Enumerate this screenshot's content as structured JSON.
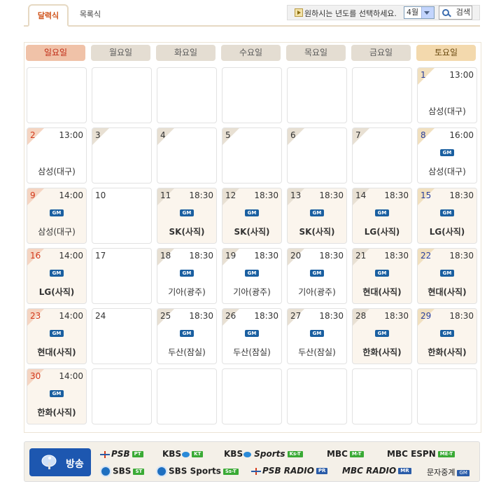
{
  "tabs": {
    "calendar": "달력식",
    "list": "목록식"
  },
  "selector": {
    "prompt": "원하시는 년도를 선택하세요.",
    "month": "4월",
    "search": "검색"
  },
  "weekdays": [
    "일요일",
    "월요일",
    "화요일",
    "수요일",
    "목요일",
    "금요일",
    "토요일"
  ],
  "days": {
    "d1": {
      "num": "1",
      "time": "13:00",
      "opp": "삼성(대구)",
      "gm": ""
    },
    "d2": {
      "num": "2",
      "time": "13:00",
      "opp": "삼성(대구)",
      "gm": ""
    },
    "d3": {
      "num": "3"
    },
    "d4": {
      "num": "4"
    },
    "d5": {
      "num": "5"
    },
    "d6": {
      "num": "6"
    },
    "d7": {
      "num": "7"
    },
    "d8": {
      "num": "8",
      "time": "16:00",
      "opp": "삼성(대구)",
      "gm": "GM"
    },
    "d9": {
      "num": "9",
      "time": "14:00",
      "opp": "삼성(대구)",
      "gm": "GM"
    },
    "d10": {
      "num": "10"
    },
    "d11": {
      "num": "11",
      "time": "18:30",
      "opp": "SK(사직)",
      "gm": "GM"
    },
    "d12": {
      "num": "12",
      "time": "18:30",
      "opp": "SK(사직)",
      "gm": "GM"
    },
    "d13": {
      "num": "13",
      "time": "18:30",
      "opp": "SK(사직)",
      "gm": "GM"
    },
    "d14": {
      "num": "14",
      "time": "18:30",
      "opp": "LG(사직)",
      "gm": "GM"
    },
    "d15": {
      "num": "15",
      "time": "18:30",
      "opp": "LG(사직)",
      "gm": "GM"
    },
    "d16": {
      "num": "16",
      "time": "14:00",
      "opp": "LG(사직)",
      "gm": "GM"
    },
    "d17": {
      "num": "17"
    },
    "d18": {
      "num": "18",
      "time": "18:30",
      "opp": "기아(광주)",
      "gm": "GM"
    },
    "d19": {
      "num": "19",
      "time": "18:30",
      "opp": "기아(광주)",
      "gm": "GM"
    },
    "d20": {
      "num": "20",
      "time": "18:30",
      "opp": "기아(광주)",
      "gm": "GM"
    },
    "d21": {
      "num": "21",
      "time": "18:30",
      "opp": "현대(사직)",
      "gm": "GM"
    },
    "d22": {
      "num": "22",
      "time": "18:30",
      "opp": "현대(사직)",
      "gm": "GM"
    },
    "d23": {
      "num": "23",
      "time": "14:00",
      "opp": "현대(사직)",
      "gm": "GM"
    },
    "d24": {
      "num": "24"
    },
    "d25": {
      "num": "25",
      "time": "18:30",
      "opp": "두산(잠실)",
      "gm": "GM"
    },
    "d26": {
      "num": "26",
      "time": "18:30",
      "opp": "두산(잠실)",
      "gm": "GM"
    },
    "d27": {
      "num": "27",
      "time": "18:30",
      "opp": "두산(잠실)",
      "gm": "GM"
    },
    "d28": {
      "num": "28",
      "time": "18:30",
      "opp": "한화(사직)",
      "gm": "GM"
    },
    "d29": {
      "num": "29",
      "time": "18:30",
      "opp": "한화(사직)",
      "gm": "GM"
    },
    "d30": {
      "num": "30",
      "time": "14:00",
      "opp": "한화(사직)",
      "gm": "GM"
    }
  },
  "broadcast": {
    "label": "방송",
    "psb": "PSB",
    "psb_badge": "PT",
    "kbs": "KBS",
    "kbs_badge": "KT",
    "kbs_sports": "KBS",
    "kbs_sports_suffix": "Sports",
    "kbs_sports_badge": "Ks-T",
    "mbc": "MBC",
    "mbc_badge": "M-T",
    "mbc_espn": "MBC ESPN",
    "mbc_espn_badge": "ME-T",
    "sbs": "SBS",
    "sbs_badge": "ST",
    "sbs_sports": "SBS Sports",
    "sbs_sports_badge": "Ss-T",
    "psb_radio": "PSB RADIO",
    "psb_radio_badge": "PR",
    "mbc_radio": "MBC RADIO",
    "mbc_radio_badge": "MR",
    "text_relay": "문자중계",
    "text_relay_badge": "GM"
  },
  "colors": {
    "sunday": "#d33a1c",
    "saturday": "#2a3f9a",
    "gm_badge": "#1a5fa0",
    "broadcast_button": "#1d57b0"
  }
}
